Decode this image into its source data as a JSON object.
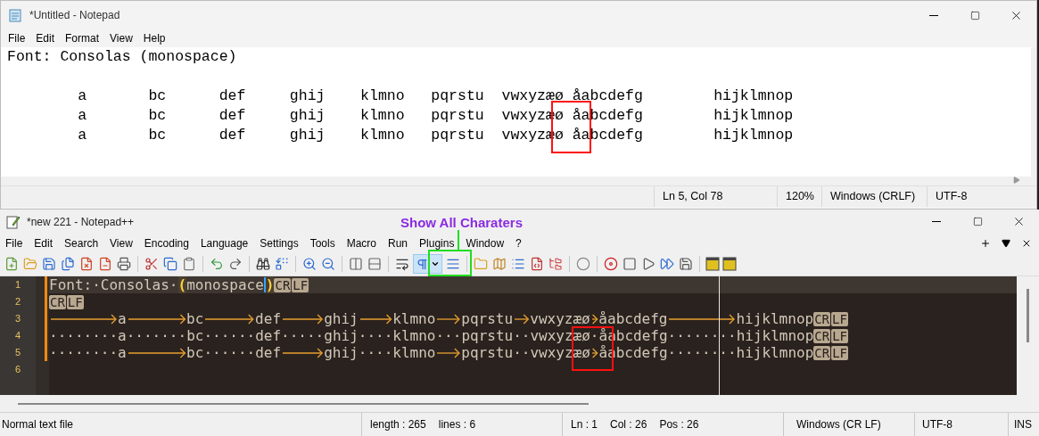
{
  "notepad": {
    "title": "*Untitled - Notepad",
    "menu": [
      "File",
      "Edit",
      "Format",
      "View",
      "Help"
    ],
    "heading_line": "Font: Consolas (monospace)",
    "lines": [
      "\ta\tbc\tdef\tghij\tklmno\tpqrstu\tvwxyzæø\tåabcdefg\thijklmnop",
      "        a       bc      def     ghij    klmno   pqrstu  vwxyzæø åabcdefg        hijklmnop",
      "        a\tbc      def\tghij    klmno\tpqrstu  vwxyzæø\tåabcdefg        hijklmnop"
    ],
    "status_bar": [
      "Ln 5, Col 78",
      "120%",
      "Windows (CRLF)",
      "UTF-8"
    ]
  },
  "annotation": {
    "label": "Show All Charaters"
  },
  "notepadpp": {
    "title": "*new 221 - Notepad++",
    "menu": [
      "File",
      "Edit",
      "Search",
      "View",
      "Encoding",
      "Language",
      "Settings",
      "Tools",
      "Macro",
      "Run",
      "Plugins",
      "Window",
      "?"
    ],
    "show_all_characters": {
      "pressed": true
    },
    "editor": {
      "lines": [
        {
          "number": "1",
          "current": true,
          "segments": [
            {
              "kind": "text",
              "text": "Font:·Consolas·"
            },
            {
              "kind": "brace",
              "text": "("
            },
            {
              "kind": "text",
              "text": "monospace"
            },
            {
              "kind": "caret"
            },
            {
              "kind": "brace",
              "text": ")"
            },
            {
              "kind": "eol",
              "text": "CR"
            },
            {
              "kind": "eol",
              "text": "LF"
            }
          ]
        },
        {
          "number": "2",
          "current": false,
          "segments": [
            {
              "kind": "eol",
              "text": "CR"
            },
            {
              "kind": "eol",
              "text": "LF"
            }
          ]
        },
        {
          "number": "3",
          "current": false,
          "segments": [
            {
              "kind": "tab"
            },
            {
              "kind": "text",
              "text": "a"
            },
            {
              "kind": "tab"
            },
            {
              "kind": "text",
              "text": "bc"
            },
            {
              "kind": "tab"
            },
            {
              "kind": "text",
              "text": "def"
            },
            {
              "kind": "tab"
            },
            {
              "kind": "text",
              "text": "ghij"
            },
            {
              "kind": "tab"
            },
            {
              "kind": "text",
              "text": "klmno"
            },
            {
              "kind": "tab"
            },
            {
              "kind": "text",
              "text": "pqrstu"
            },
            {
              "kind": "tab"
            },
            {
              "kind": "text",
              "text": "vwxyzæø"
            },
            {
              "kind": "tab"
            },
            {
              "kind": "text",
              "text": "åabcdefg"
            },
            {
              "kind": "tab"
            },
            {
              "kind": "text",
              "text": "hijklmnop"
            },
            {
              "kind": "eol",
              "text": "CR"
            },
            {
              "kind": "eol",
              "text": "LF"
            }
          ]
        },
        {
          "number": "4",
          "current": false,
          "segments": [
            {
              "kind": "text",
              "text": "········a·······bc······def·····ghij····klmno···pqrstu··vwxyzæø·åabcdefg········hijklmnop"
            },
            {
              "kind": "eol",
              "text": "CR"
            },
            {
              "kind": "eol",
              "text": "LF"
            }
          ]
        },
        {
          "number": "5",
          "current": false,
          "segments": [
            {
              "kind": "text",
              "text": "········a"
            },
            {
              "kind": "tab"
            },
            {
              "kind": "text",
              "text": "bc······def"
            },
            {
              "kind": "tab"
            },
            {
              "kind": "text",
              "text": "ghij····klmno"
            },
            {
              "kind": "tab"
            },
            {
              "kind": "text",
              "text": "pqrstu··vwxyzæø"
            },
            {
              "kind": "tab"
            },
            {
              "kind": "text",
              "text": "åabcdefg········hijklmnop"
            },
            {
              "kind": "eol",
              "text": "CR"
            },
            {
              "kind": "eol",
              "text": "LF"
            }
          ]
        },
        {
          "number": "6",
          "current": false
        }
      ]
    },
    "status_bar": {
      "file_type": "Normal text file",
      "length": "length : 265",
      "lines": "lines : 6",
      "line": "Ln : 1",
      "column": "Col : 26",
      "position": "Pos : 26",
      "eol": "Windows (CR LF)",
      "encoding": "UTF-8",
      "mode": "INS"
    }
  }
}
